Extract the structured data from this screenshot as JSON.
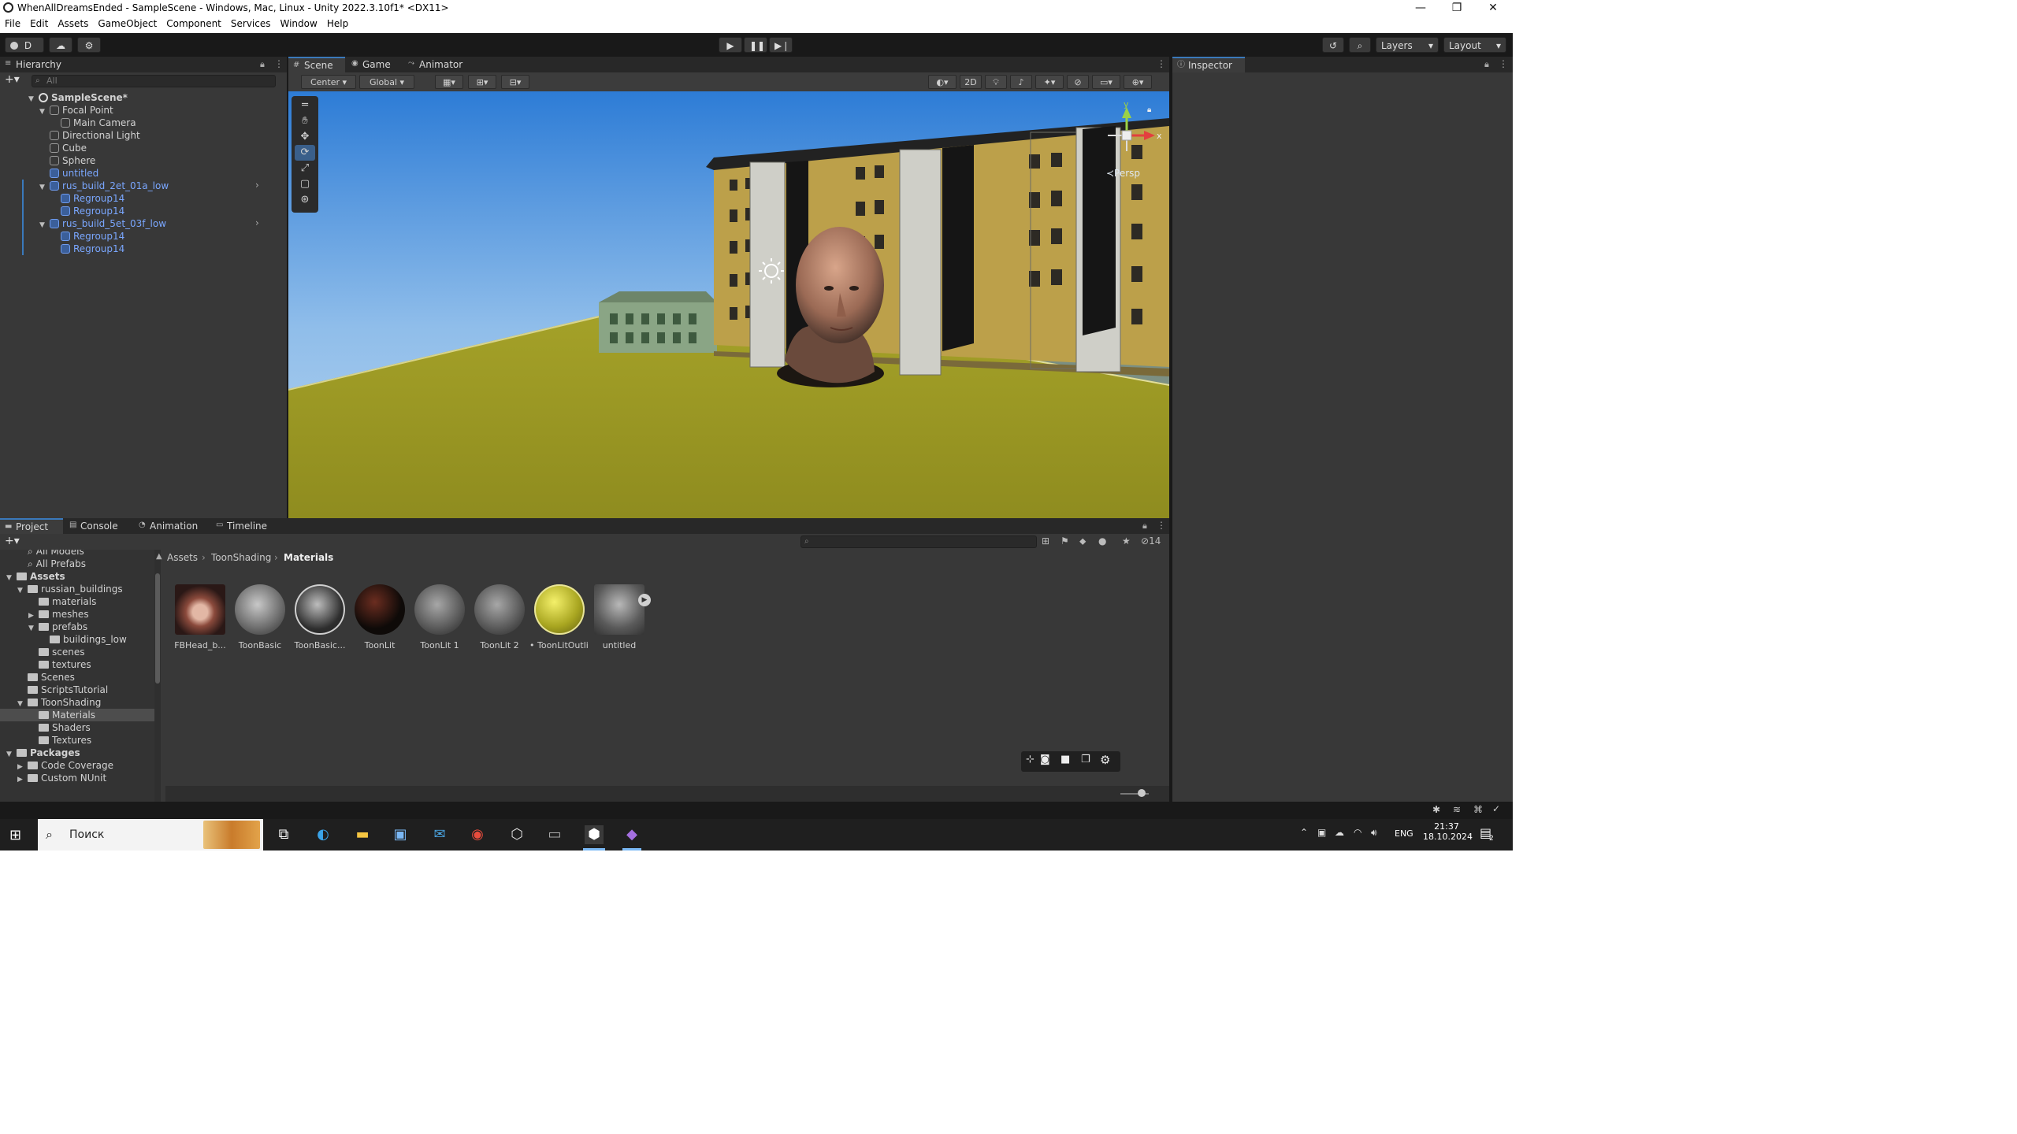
{
  "window": {
    "title": "WhenAllDreamsEnded - SampleScene - Windows, Mac, Linux - Unity 2022.3.10f1* <DX11>",
    "controls": {
      "minimize": "—",
      "restore": "❐",
      "close": "✕"
    }
  },
  "menu": [
    "File",
    "Edit",
    "Assets",
    "GameObject",
    "Component",
    "Services",
    "Window",
    "Help"
  ],
  "toolbar": {
    "account_label": "D",
    "layers_label": "Layers",
    "layout_label": "Layout",
    "play_icon": "play-icon",
    "pause_icon": "pause-icon",
    "step_icon": "step-icon"
  },
  "hierarchy": {
    "tab": "Hierarchy",
    "search_placeholder": "All",
    "items": [
      {
        "label": "SampleScene*",
        "depth": 0,
        "kind": "scene",
        "blue": false,
        "arrow": "▼"
      },
      {
        "label": "Focal Point",
        "depth": 1,
        "kind": "object",
        "blue": false,
        "arrow": "▼"
      },
      {
        "label": "Main Camera",
        "depth": 2,
        "kind": "object",
        "blue": false,
        "arrow": ""
      },
      {
        "label": "Directional Light",
        "depth": 1,
        "kind": "object",
        "blue": false,
        "arrow": ""
      },
      {
        "label": "Cube",
        "depth": 1,
        "kind": "object",
        "blue": false,
        "arrow": ""
      },
      {
        "label": "Sphere",
        "depth": 1,
        "kind": "object",
        "blue": false,
        "arrow": ""
      },
      {
        "label": "untitled",
        "depth": 1,
        "kind": "prefab",
        "blue": true,
        "arrow": ""
      },
      {
        "label": "rus_build_2et_01a_low",
        "depth": 1,
        "kind": "prefab",
        "blue": true,
        "arrow": "▼"
      },
      {
        "label": "Regroup14",
        "depth": 2,
        "kind": "prefab",
        "blue": true,
        "arrow": ""
      },
      {
        "label": "Regroup14",
        "depth": 2,
        "kind": "prefab",
        "blue": true,
        "arrow": ""
      },
      {
        "label": "rus_build_5et_03f_low",
        "depth": 1,
        "kind": "prefab",
        "blue": true,
        "arrow": "▼"
      },
      {
        "label": "Regroup14",
        "depth": 2,
        "kind": "prefab",
        "blue": true,
        "arrow": ""
      },
      {
        "label": "Regroup14",
        "depth": 2,
        "kind": "prefab",
        "blue": true,
        "arrow": ""
      }
    ]
  },
  "scene_tabs": [
    {
      "label": "Scene",
      "icon": "grid-icon",
      "active": true
    },
    {
      "label": "Game",
      "icon": "gamepad-icon",
      "active": false
    },
    {
      "label": "Animator",
      "icon": "animator-icon",
      "active": false
    }
  ],
  "scene_toolbar": {
    "pivot": "Center",
    "space": "Global",
    "mode_2d": "2D"
  },
  "scene_view": {
    "persp_label": "≺Persp",
    "gizmo_y": "y",
    "gizmo_x": "x"
  },
  "inspector": {
    "tab": "Inspector"
  },
  "bottom_tabs": [
    {
      "label": "Project",
      "icon": "folder-icon",
      "active": true
    },
    {
      "label": "Console",
      "icon": "console-icon",
      "active": false
    },
    {
      "label": "Animation",
      "icon": "animation-icon",
      "active": false
    },
    {
      "label": "Timeline",
      "icon": "timeline-icon",
      "active": false
    }
  ],
  "project": {
    "breadcrumb": [
      "Assets",
      "ToonShading",
      "Materials"
    ],
    "hidden_count": "14",
    "tree": [
      {
        "label": "All Models",
        "depth": 1,
        "kind": "search",
        "bold": false,
        "selected": false,
        "arrow": ""
      },
      {
        "label": "All Prefabs",
        "depth": 1,
        "kind": "search",
        "bold": false,
        "selected": false,
        "arrow": ""
      },
      {
        "label": "Assets",
        "depth": 0,
        "kind": "folder",
        "bold": true,
        "selected": false,
        "arrow": "▼"
      },
      {
        "label": "russian_buildings",
        "depth": 1,
        "kind": "folder",
        "bold": false,
        "selected": false,
        "arrow": "▼"
      },
      {
        "label": "materials",
        "depth": 2,
        "kind": "folder",
        "bold": false,
        "selected": false,
        "arrow": ""
      },
      {
        "label": "meshes",
        "depth": 2,
        "kind": "folder",
        "bold": false,
        "selected": false,
        "arrow": "▶"
      },
      {
        "label": "prefabs",
        "depth": 2,
        "kind": "folder",
        "bold": false,
        "selected": false,
        "arrow": "▼"
      },
      {
        "label": "buildings_low",
        "depth": 3,
        "kind": "folder",
        "bold": false,
        "selected": false,
        "arrow": ""
      },
      {
        "label": "scenes",
        "depth": 2,
        "kind": "folder",
        "bold": false,
        "selected": false,
        "arrow": ""
      },
      {
        "label": "textures",
        "depth": 2,
        "kind": "folder",
        "bold": false,
        "selected": false,
        "arrow": ""
      },
      {
        "label": "Scenes",
        "depth": 1,
        "kind": "folder",
        "bold": false,
        "selected": false,
        "arrow": ""
      },
      {
        "label": "ScriptsTutorial",
        "depth": 1,
        "kind": "folder",
        "bold": false,
        "selected": false,
        "arrow": ""
      },
      {
        "label": "ToonShading",
        "depth": 1,
        "kind": "folder",
        "bold": false,
        "selected": false,
        "arrow": "▼"
      },
      {
        "label": "Materials",
        "depth": 2,
        "kind": "folder",
        "bold": false,
        "selected": true,
        "arrow": ""
      },
      {
        "label": "Shaders",
        "depth": 2,
        "kind": "folder",
        "bold": false,
        "selected": false,
        "arrow": ""
      },
      {
        "label": "Textures",
        "depth": 2,
        "kind": "folder",
        "bold": false,
        "selected": false,
        "arrow": ""
      },
      {
        "label": "Packages",
        "depth": 0,
        "kind": "folder",
        "bold": true,
        "selected": false,
        "arrow": "▼"
      },
      {
        "label": "Code Coverage",
        "depth": 1,
        "kind": "folder",
        "bold": false,
        "selected": false,
        "arrow": "▶"
      },
      {
        "label": "Custom NUnit",
        "depth": 1,
        "kind": "folder",
        "bold": false,
        "selected": false,
        "arrow": "▶"
      }
    ],
    "assets": [
      {
        "label": "FBHead_b...",
        "icon": "head-material-icon"
      },
      {
        "label": "ToonBasic",
        "icon": "material-sphere-icon"
      },
      {
        "label": "ToonBasic...",
        "icon": "material-sphere-icon"
      },
      {
        "label": "ToonLit",
        "icon": "material-sphere-icon"
      },
      {
        "label": "ToonLit 1",
        "icon": "material-sphere-icon"
      },
      {
        "label": "ToonLit 2",
        "icon": "material-sphere-icon"
      },
      {
        "label": "• ToonLitOutli...",
        "icon": "material-sphere-icon"
      },
      {
        "label": "untitled",
        "icon": "model-prefab-icon"
      }
    ]
  },
  "taskbar": {
    "search_placeholder": "Поиск",
    "lang": "ENG",
    "time": "21:37",
    "date": "18.10.2024",
    "notifications": "2"
  },
  "colors": {
    "accent": "#3a79bb",
    "ground": "#a6a329",
    "sky_top": "#2d7cd6",
    "sky_bottom": "#9cc7ec",
    "prefab_blue": "#7aa7ff"
  }
}
